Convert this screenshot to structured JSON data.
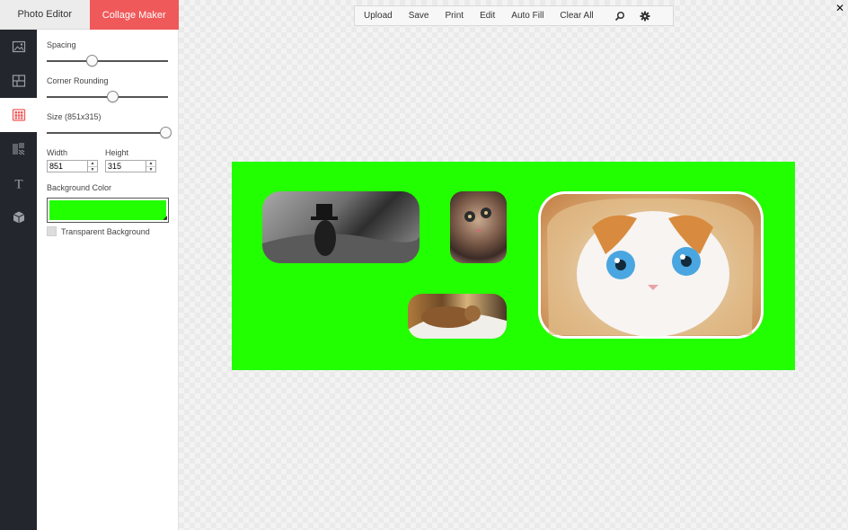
{
  "tabs": {
    "photo_editor": "Photo Editor",
    "collage_maker": "Collage Maker"
  },
  "rail": [
    "image-icon",
    "layout-icon",
    "grid-icon",
    "texture-icon",
    "text-icon",
    "cube-icon"
  ],
  "panel": {
    "spacing_label": "Spacing",
    "spacing_value": 0.37,
    "corner_label": "Corner Rounding",
    "corner_value": 0.54,
    "size_label": "Size (851x315)",
    "size_value": 0.98,
    "width_label": "Width",
    "width_value": "851",
    "height_label": "Height",
    "height_value": "315",
    "bg_color_label": "Background Color",
    "bg_color": "#22ff00",
    "transparent_label": "Transparent Background"
  },
  "toolbar": {
    "upload": "Upload",
    "save": "Save",
    "print": "Print",
    "edit": "Edit",
    "auto_fill": "Auto Fill",
    "clear_all": "Clear All"
  },
  "colors": {
    "accent": "#f0595a",
    "rail_bg": "#23272d",
    "collage_bg": "#22ff00"
  }
}
